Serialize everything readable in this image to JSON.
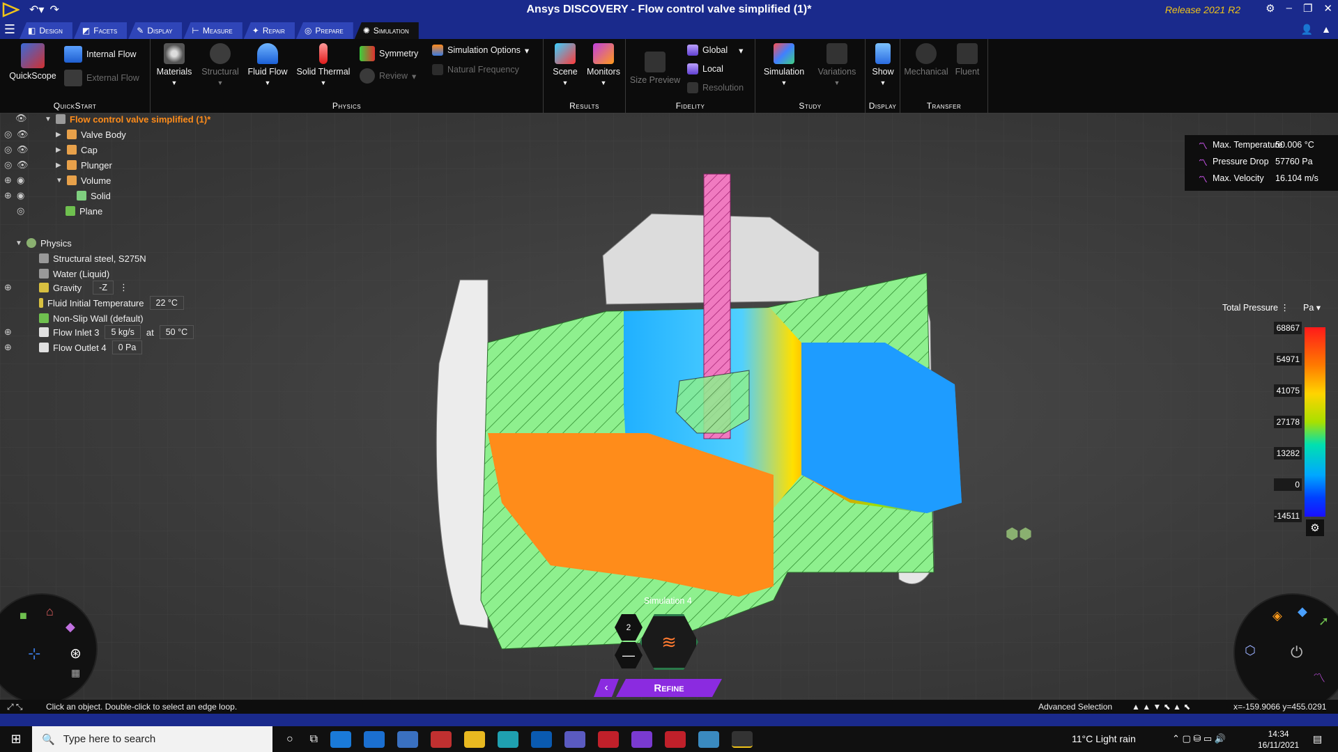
{
  "window": {
    "title": "Ansys DISCOVERY - Flow control valve simplified (1)*",
    "release": "Release 2021 R2"
  },
  "tabs": [
    {
      "label": "Design",
      "icon": "design-icon"
    },
    {
      "label": "Facets",
      "icon": "facets-icon"
    },
    {
      "label": "Display",
      "icon": "display-icon"
    },
    {
      "label": "Measure",
      "icon": "measure-icon"
    },
    {
      "label": "Repair",
      "icon": "repair-icon"
    },
    {
      "label": "Prepare",
      "icon": "prepare-icon"
    },
    {
      "label": "Simulation",
      "icon": "simulation-icon",
      "active": true
    }
  ],
  "ribbon": {
    "quickstart": {
      "label": "QuickStart",
      "quickscope": "QuickScope",
      "internal_flow": "Internal Flow",
      "external_flow": "External Flow"
    },
    "physics": {
      "label": "Physics",
      "materials": "Materials",
      "structural": "Structural",
      "fluid_flow": "Fluid Flow",
      "solid_thermal": "Solid Thermal",
      "symmetry": "Symmetry",
      "review": "Review",
      "simulation_options": "Simulation Options",
      "natural_frequency": "Natural Frequency"
    },
    "results": {
      "label": "Results",
      "scene": "Scene",
      "monitors": "Monitors"
    },
    "fidelity": {
      "label": "Fidelity",
      "size_preview": "Size Preview",
      "global": "Global",
      "local": "Local",
      "resolution": "Resolution"
    },
    "study": {
      "label": "Study",
      "simulation": "Simulation",
      "variations": "Variations"
    },
    "display": {
      "label": "Display",
      "show": "Show"
    },
    "transfer": {
      "label": "Transfer",
      "mechanical": "Mechanical",
      "fluent": "Fluent"
    }
  },
  "tree": {
    "root": "Flow control valve simplified (1)*",
    "items": [
      "Valve Body",
      "Cap",
      "Plunger",
      "Volume",
      "Solid",
      "Plane"
    ],
    "physics": {
      "label": "Physics",
      "material1": "Structural steel, S275N",
      "material2": "Water (Liquid)",
      "gravity": {
        "label": "Gravity",
        "value": "-Z"
      },
      "fluid_temp": {
        "label": "Fluid Initial Temperature",
        "value": "22 °C"
      },
      "wall": "Non-Slip Wall (default)",
      "inlet": {
        "label": "Flow Inlet 3",
        "flow": "5 kg/s",
        "at": "at",
        "temp": "50 °C"
      },
      "outlet": {
        "label": "Flow Outlet 4",
        "value": "0 Pa"
      }
    }
  },
  "results": [
    {
      "name": "Max. Temperature",
      "value": "50.006 °C"
    },
    {
      "name": "Pressure Drop",
      "value": "57760 Pa"
    },
    {
      "name": "Max. Velocity",
      "value": "16.104 m/s"
    }
  ],
  "legend": {
    "title": "Total Pressure",
    "unit": "Pa",
    "ticks": [
      "68867",
      "54971",
      "41075",
      "27178",
      "13282",
      "0",
      "-14511"
    ]
  },
  "simulation": {
    "label": "Simulation 4",
    "count": "2",
    "refine": "Refine"
  },
  "status": {
    "message": "Click an object. Double-click to select an edge loop.",
    "selection": "Advanced Selection",
    "coords": "x=-159.9066  y=455.0291"
  },
  "taskbar": {
    "search_placeholder": "Type here to search",
    "weather": "11°C  Light rain",
    "time": "14:34",
    "date": "16/11/2021"
  },
  "colors": {
    "accent": "#1a2a8c",
    "tab": "#2f45b8",
    "refine": "#8b2be0",
    "highlight": "#ff8c1a"
  }
}
